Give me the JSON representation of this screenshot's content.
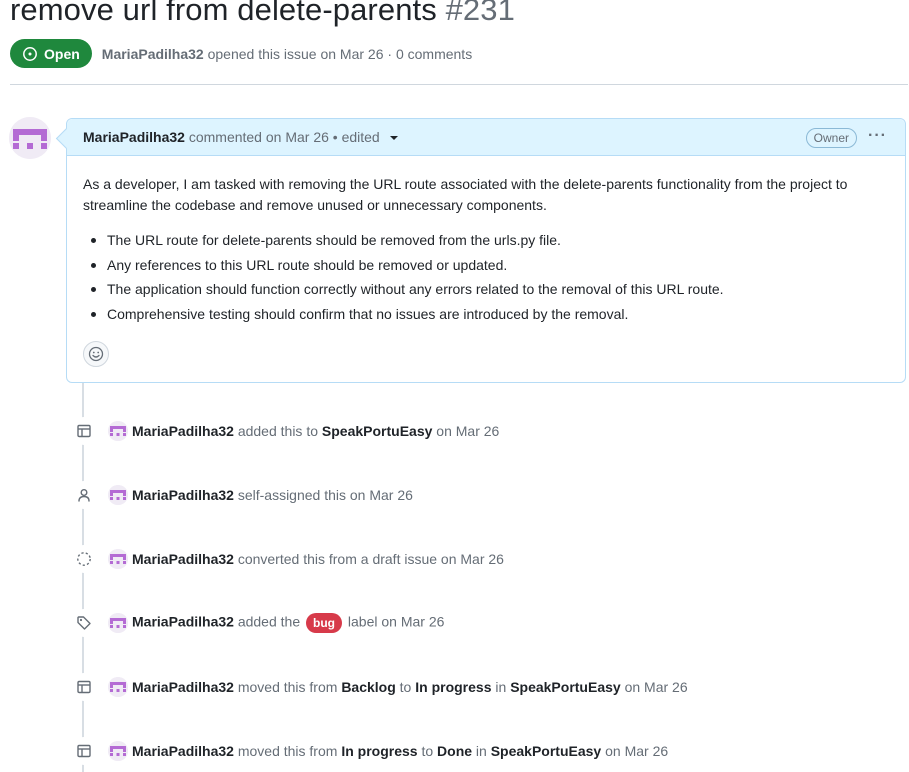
{
  "issue": {
    "title": "remove url from delete-parents",
    "number": "#231",
    "state": "Open",
    "author": "MariaPadilha32",
    "meta_rest": "opened this issue on Mar 26 · 0 comments"
  },
  "comment": {
    "author": "MariaPadilha32",
    "meta": "commented on Mar 26 • edited",
    "role": "Owner",
    "more": "···",
    "paragraph": "As a developer, I am tasked with removing the URL route associated with the delete-parents functionality from the project to streamline the codebase and remove unused or unnecessary components.",
    "bullets": [
      "The URL route for delete-parents should be removed from the urls.py file.",
      "Any references to this URL route should be removed or updated.",
      "The application should function correctly without any errors related to the removal of this URL route.",
      "Comprehensive testing should confirm that no issues are introduced by the removal."
    ]
  },
  "events": [
    {
      "icon": "project-table-icon",
      "actor": "MariaPadilha32",
      "t1": "added this to",
      "b1": "SpeakPortuEasy",
      "t2": "on Mar 26"
    },
    {
      "icon": "person-icon",
      "actor": "MariaPadilha32",
      "t1": "self-assigned this on Mar 26"
    },
    {
      "icon": "draft-circle-icon",
      "actor": "MariaPadilha32",
      "t1": "converted this from a draft issue on Mar 26"
    },
    {
      "icon": "tag-icon",
      "actor": "MariaPadilha32",
      "t1": "added the",
      "label": "bug",
      "t2": "label on Mar 26"
    },
    {
      "icon": "project-table-icon",
      "actor": "MariaPadilha32",
      "t1": "moved this from",
      "b1": "Backlog",
      "t2": "to",
      "b2": "In progress",
      "t3": "in",
      "b3": "SpeakPortuEasy",
      "t4": "on Mar 26"
    },
    {
      "icon": "project-table-icon",
      "actor": "MariaPadilha32",
      "t1": "moved this from",
      "b1": "In progress",
      "t2": "to",
      "b2": "Done",
      "t3": "in",
      "b3": "SpeakPortuEasy",
      "t4": "on Mar 26"
    }
  ],
  "colors": {
    "open_green": "#1f883d",
    "bug_red": "#d73a4a",
    "comment_header": "#ddf4ff",
    "avatar_purple": "#b46bd4"
  }
}
